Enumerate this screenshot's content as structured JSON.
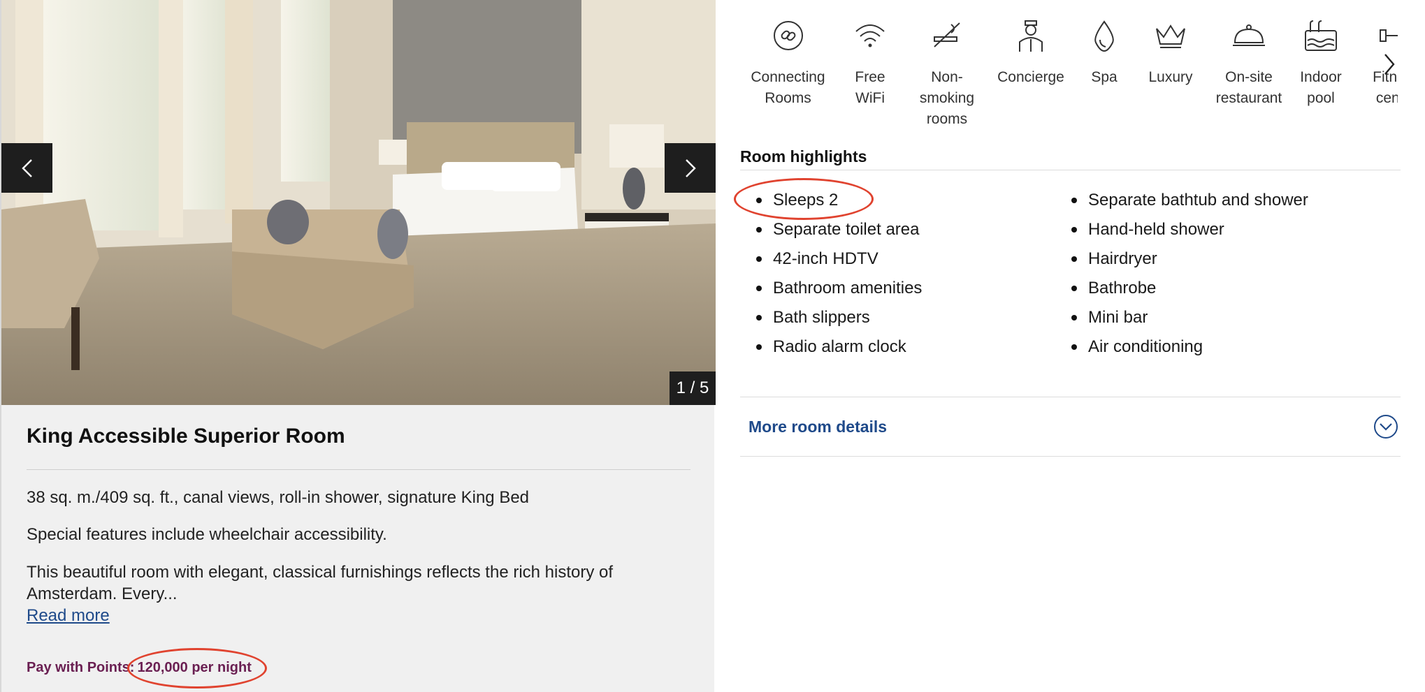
{
  "gallery": {
    "counter": "1 / 5",
    "prev_icon": "chevron-left-icon",
    "next_icon": "chevron-right-icon"
  },
  "room": {
    "title": "King Accessible Superior Room",
    "summary": "38 sq. m./409 sq. ft., canal views, roll-in shower, signature King Bed",
    "special": "Special features include wheelchair accessibility.",
    "description": "This beautiful room with elegant, classical furnishings reflects the rich history of Amsterdam. Every...",
    "read_more": "Read more",
    "points_label": "Pay with Points:",
    "points_value": "120,000 per night"
  },
  "amenities": [
    {
      "icon": "connecting-rooms-icon",
      "label": "Connecting Rooms"
    },
    {
      "icon": "wifi-icon",
      "label": "Free WiFi"
    },
    {
      "icon": "no-smoking-icon",
      "label": "Non-smoking rooms"
    },
    {
      "icon": "concierge-icon",
      "label": "Concierge"
    },
    {
      "icon": "spa-icon",
      "label": "Spa"
    },
    {
      "icon": "luxury-crown-icon",
      "label": "Luxury"
    },
    {
      "icon": "restaurant-cloche-icon",
      "label": "On-site restaurant"
    },
    {
      "icon": "indoor-pool-icon",
      "label": "Indoor pool"
    },
    {
      "icon": "fitness-center-icon",
      "label": "Fitness center"
    }
  ],
  "highlights": {
    "title": "Room highlights",
    "col1": [
      "Sleeps 2",
      "Separate toilet area",
      "42-inch HDTV",
      "Bathroom amenities",
      "Bath slippers",
      "Radio alarm clock"
    ],
    "col2": [
      "Separate bathtub and shower",
      "Hand-held shower",
      "Hairdryer",
      "Bathrobe",
      "Mini bar",
      "Air conditioning"
    ]
  },
  "more_details": {
    "label": "More room details",
    "icon": "chevron-down-circle-icon"
  },
  "colors": {
    "link": "#1f4a8a",
    "points": "#6a1f52",
    "annotation": "#e0432f"
  }
}
